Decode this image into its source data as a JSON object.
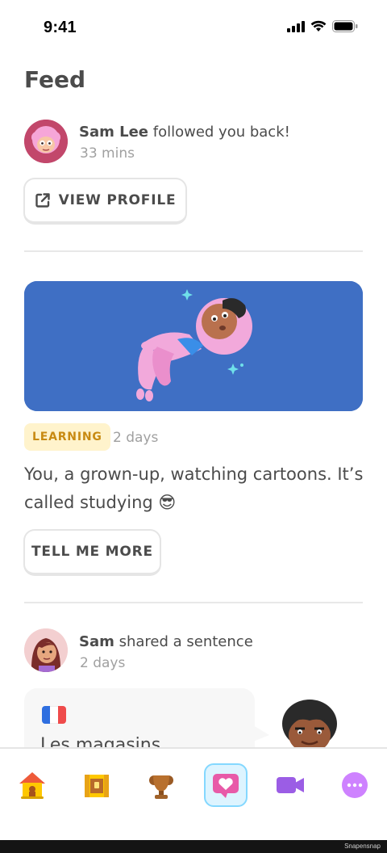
{
  "status_bar": {
    "time": "9:41"
  },
  "feed": {
    "title": "Feed"
  },
  "notification": {
    "name": "Sam Lee",
    "action": " followed you back!",
    "time": "33 mins",
    "button_label": "VIEW PROFILE"
  },
  "learning_post": {
    "badge": "LEARNING",
    "time": "2 days",
    "text": "You, a grown-up, watching cartoons. It’s called studying 😎",
    "button_label": "TELL ME MORE"
  },
  "share_post": {
    "name": "Sam",
    "action": " shared a sentence",
    "time": "2 days",
    "sentence": "Les magasins"
  },
  "tab_bar": {
    "items": [
      {
        "icon": "home-icon",
        "active": false
      },
      {
        "icon": "treasure-chest-icon",
        "active": false
      },
      {
        "icon": "trophy-icon",
        "active": false
      },
      {
        "icon": "feed-heart-icon",
        "active": true
      },
      {
        "icon": "video-call-icon",
        "active": false
      },
      {
        "icon": "more-icon",
        "active": false
      }
    ]
  },
  "footer": {
    "label": "Snapensnap"
  },
  "colors": {
    "hero_background": "#3f6fc4",
    "badge_background": "#fff3cc",
    "badge_text": "#c88a12",
    "active_tab_background": "#ddf4ff",
    "active_tab_border": "#84d8ff",
    "text": "#4b4b4b",
    "muted_text": "#a0a0a0"
  }
}
